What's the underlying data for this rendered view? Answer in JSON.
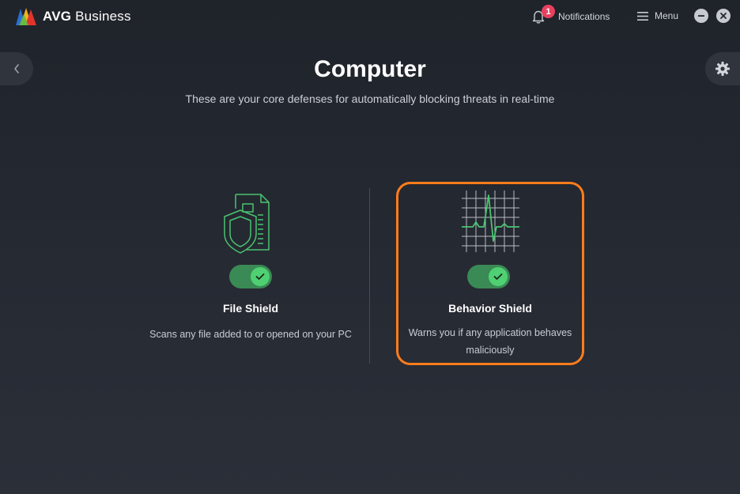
{
  "app": {
    "brand_bold": "AVG",
    "brand_rest": " Business"
  },
  "header": {
    "notifications_count": "1",
    "notifications_label": "Notifications",
    "menu_label": "Menu"
  },
  "page": {
    "title": "Computer",
    "subtitle": "These are your core defenses for automatically blocking threats in real-time"
  },
  "shields": [
    {
      "title": "File Shield",
      "description": "Scans any file added to or opened on your PC",
      "enabled": true,
      "icon": "file-shield-icon"
    },
    {
      "title": "Behavior Shield",
      "description": "Warns you if any application behaves maliciously",
      "enabled": true,
      "icon": "behavior-shield-icon"
    }
  ],
  "colors": {
    "accent_green": "#4fd072",
    "toggle_track": "#3a8a55",
    "highlight_orange": "#ff7d1c",
    "badge_red": "#e8405e"
  }
}
